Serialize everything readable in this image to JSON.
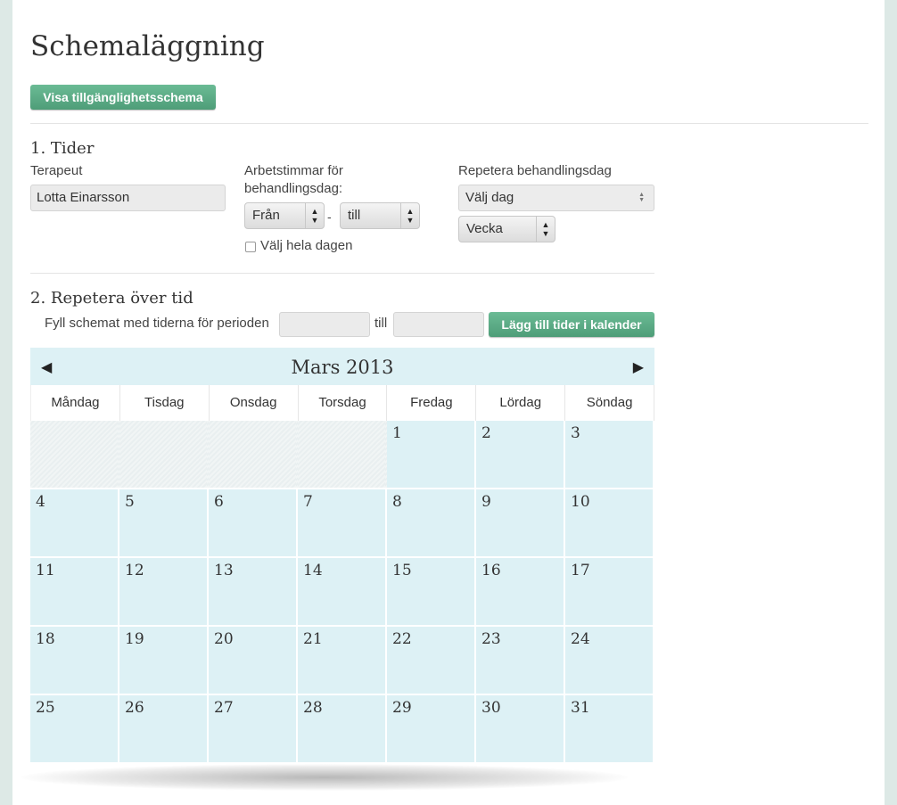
{
  "page_title": "Schemaläggning",
  "show_availability_button": "Visa tillgänglighetsschema",
  "section1": {
    "heading": "1. Tider",
    "therapist_label": "Terapeut",
    "therapist_value": "Lotta Einarsson",
    "hours_label_line1": "Arbetstimmar för",
    "hours_label_line2": "behandlingsdag:",
    "from_select": "Från",
    "separator": "-",
    "to_select": "till",
    "whole_day_label": "Välj hela dagen",
    "repeat_label": "Repetera behandlingsdag",
    "day_select": "Välj dag",
    "period_select": "Vecka"
  },
  "section2": {
    "heading": "2. Repetera över tid",
    "fill_label": "Fyll schemat med tiderna för perioden",
    "start_value": "",
    "till_label": "till",
    "end_value": "",
    "add_button": "Lägg till tider i kalender"
  },
  "calendar": {
    "month_title": "Mars 2013",
    "prev_icon": "◀",
    "next_icon": "▶",
    "weekdays": [
      "Måndag",
      "Tisdag",
      "Onsdag",
      "Torsdag",
      "Fredag",
      "Lördag",
      "Söndag"
    ],
    "leading_empty_days": 4,
    "days": [
      "1",
      "2",
      "3",
      "4",
      "5",
      "6",
      "7",
      "8",
      "9",
      "10",
      "11",
      "12",
      "13",
      "14",
      "15",
      "16",
      "17",
      "18",
      "19",
      "20",
      "21",
      "22",
      "23",
      "24",
      "25",
      "26",
      "27",
      "28",
      "29",
      "30",
      "31"
    ]
  },
  "colors": {
    "accent_green": "#5aa983",
    "calendar_cell": "#ddf1f5",
    "background": "#dde9e6"
  }
}
